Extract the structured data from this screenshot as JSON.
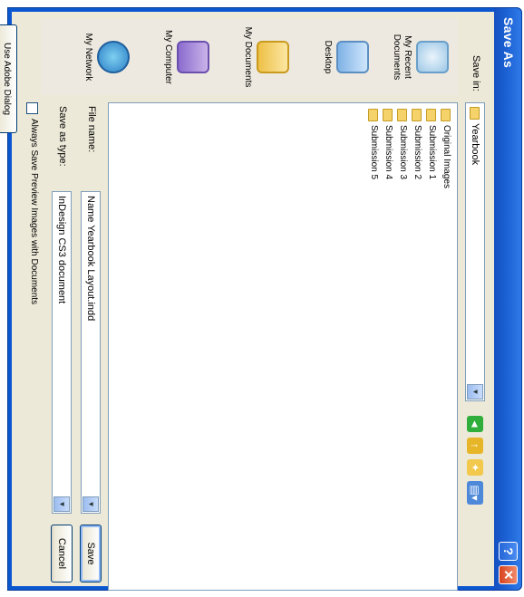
{
  "window": {
    "title": "Save As"
  },
  "save_in": {
    "label": "Save in:",
    "value": "Yearbook"
  },
  "places": [
    {
      "label": "My Recent\nDocuments",
      "icon": "recent-documents-icon"
    },
    {
      "label": "Desktop",
      "icon": "desktop-icon"
    },
    {
      "label": "My Documents",
      "icon": "my-documents-icon"
    },
    {
      "label": "My Computer",
      "icon": "my-computer-icon"
    },
    {
      "label": "My Network",
      "icon": "my-network-icon"
    }
  ],
  "files": [
    "Original Images",
    "Submission 1",
    "Submission 2",
    "Submission 3",
    "Submission 4",
    "Submission 5"
  ],
  "file_name": {
    "label": "File name:",
    "value": "Name Yearbook Layout.indd"
  },
  "save_as_type": {
    "label": "Save as type:",
    "value": "InDesign CS3 document"
  },
  "preview_checkbox": {
    "label": "Always Save Preview Images with Documents",
    "checked": false
  },
  "buttons": {
    "save": "Save",
    "cancel": "Cancel",
    "adobe_dialog": "Use Adobe Dialog"
  },
  "colors": {
    "titlebar": "#1a5fd2",
    "face": "#ece9d8",
    "close": "#d8431f"
  }
}
